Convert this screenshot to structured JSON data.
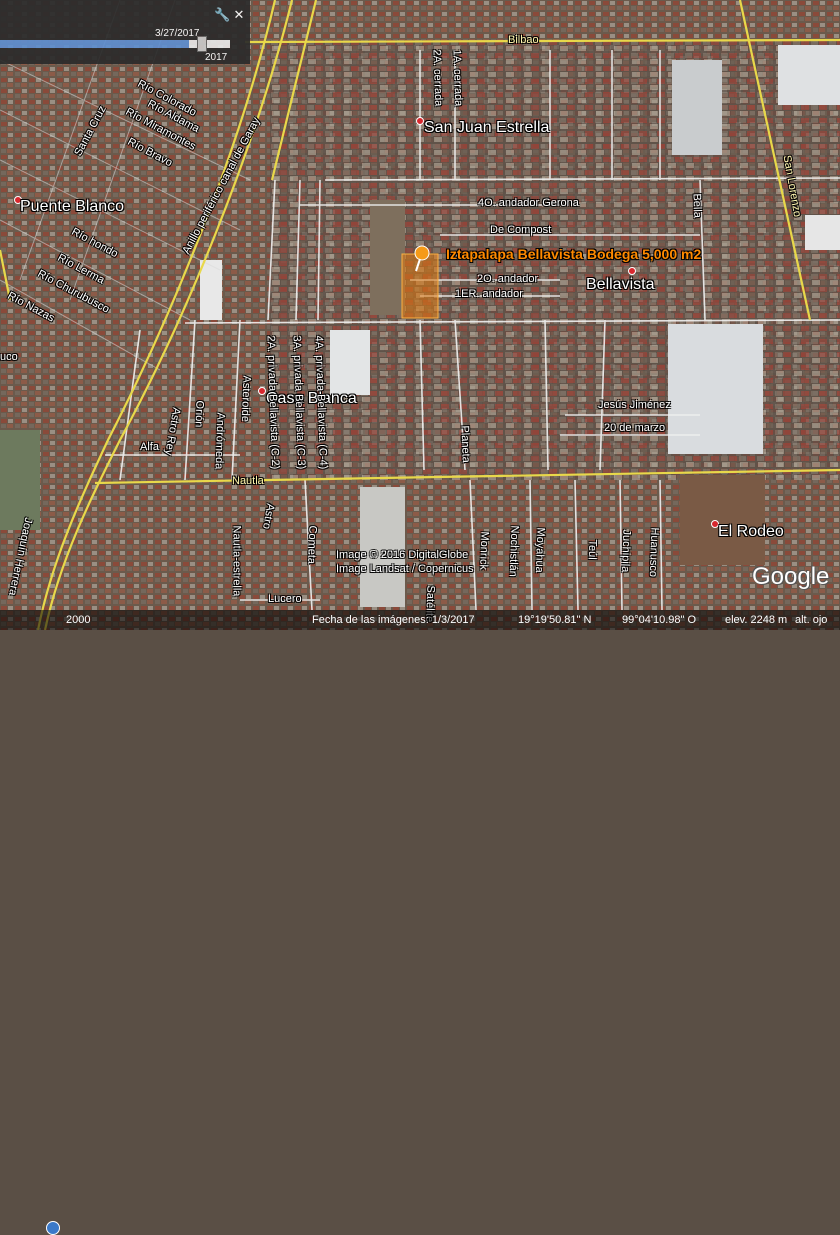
{
  "timeline": {
    "date_label": "3/27/2017",
    "year_label": "2017",
    "progress": 0.82,
    "tools_icon": "wrench-icon",
    "close_icon": "close-icon"
  },
  "streets": {
    "bilbao": "Bilbao",
    "cerrada_1a": "1A. cerrada",
    "cerrada_2a": "2A. cerrada",
    "rio_colorado": "Río Colorado",
    "rio_aldama": "Río Aldama",
    "rio_miramontes": "Río Miramontes",
    "rio_bravo": "Río Bravo",
    "rio_hondo": "Río hondo",
    "rio_lerma": "Río Lerma",
    "rio_churubusco": "Río Churubusco",
    "rio_nazas": "Río Nazas",
    "santa_cruz": "Santa Cruz",
    "anillo": "Anillo periférico canal de Garay",
    "canal_partial": "uco",
    "privada_2a": "2A. privada Bellavista (C-2)",
    "privada_3a": "3A. privada Bellavista (C-3)",
    "privada_4a": "4A. privada Bellavista (C-4)",
    "andador_4o": "4O. andador Gerona",
    "de_compost": "De Compost",
    "andador_2o": "2O. andador",
    "andador_1er": "1ER. andador",
    "bella": "Bella",
    "san_lorenzo": "San Lorenzo",
    "jesus_jimenez": "Jesús Jiménez",
    "veinte_marzo": "20 de marzo",
    "rey": "Astro Rey",
    "orion": "Orión",
    "andromeda": "Andrómeda",
    "asteroide": "Asteroide",
    "alfa": "Alfa",
    "nautla": "Nautla",
    "astro": "Astro",
    "planeta": "Planeta",
    "cometa": "Cometa",
    "satelite": "Satélite",
    "monrick": "Monrick",
    "nochistlan": "Nochistlán",
    "moyahua": "Moyahua",
    "teul": "Teúl",
    "juchipila": "Juchipila",
    "huanusco": "Huanusco",
    "nautla_estrella": "Nautla-estrella",
    "joaquin_herrera": "Joaquín Herrera",
    "lucero": "Lucero"
  },
  "places": {
    "san_juan": "San Juan Estrella",
    "puente_blanco": "Puente Blanco",
    "bellavista": "Bellavista",
    "casa_blanca": "Casa Blanca",
    "el_rodeo": "El Rodeo"
  },
  "poi": {
    "label": "Iztapalapa Bellavista Bodega 5,000 m2",
    "marker_icon": "pushpin-icon",
    "highlight_color": "#e07a10"
  },
  "credits": {
    "line1": "Image © 2016 DigitalGlobe",
    "line2": "Image Landsat / Copernicus"
  },
  "logo": "Google",
  "status": {
    "year": "2000",
    "imagery_date": "Fecha de las imágenes: 1/3/2017",
    "lat": "19°19'50.81\" N",
    "lon": "99°04'10.98\" O",
    "elev": "elev.  2248 m",
    "alt": "alt. ojo"
  },
  "colors": {
    "road_major": "#e8d84a",
    "road_minor": "#f2f2f2",
    "place_dot": "#d8282e"
  }
}
